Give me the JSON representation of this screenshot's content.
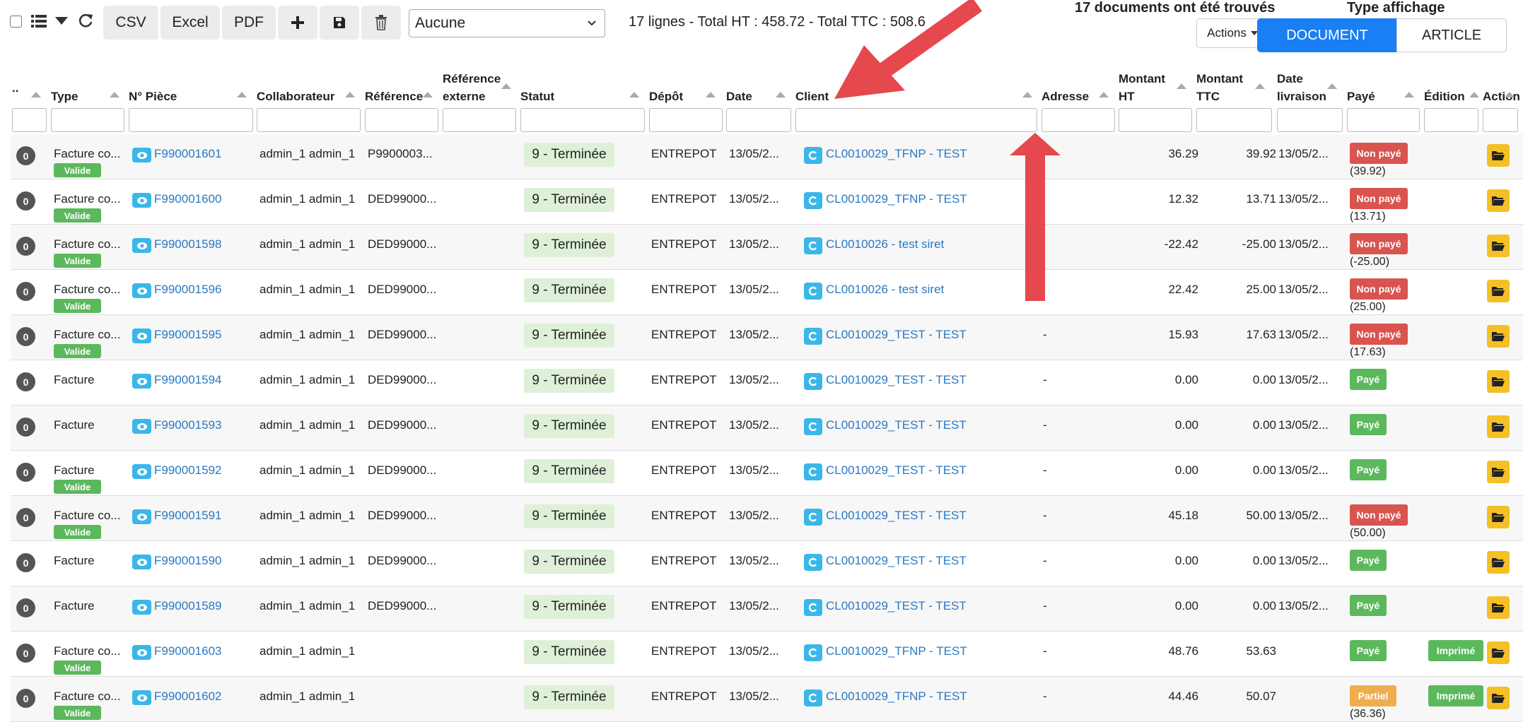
{
  "toolbar": {
    "csv_label": "CSV",
    "excel_label": "Excel",
    "pdf_label": "PDF",
    "view_select_value": "Aucune",
    "summary": "17 lignes - Total HT : 458.72 - Total TTC : 508.65"
  },
  "header": {
    "found_text": "17 documents ont été trouvés",
    "display_type_title": "Type affichage",
    "actions_label": "Actions",
    "document_label": "DOCUMENT",
    "article_label": "ARTICLE"
  },
  "columns": {
    "dots": "..",
    "type": "Type",
    "piece": "N° Pièce",
    "collab": "Collaborateur",
    "ref": "Référence",
    "refext_1": "Référence",
    "refext_2": "externe",
    "statut": "Statut",
    "depot": "Dépôt",
    "date": "Date",
    "client": "Client",
    "adresse": "Adresse",
    "mht_1": "Montant",
    "mht_2": "HT",
    "mttc_1": "Montant",
    "mttc_2": "TTC",
    "dliv_1": "Date",
    "dliv_2": "livraison",
    "paye": "Payé",
    "edition": "Édition",
    "action": "Action"
  },
  "rows": [
    {
      "badge": "0",
      "type": "Facture co...",
      "valide": "Valide",
      "piece": "F990001601",
      "collab": "admin_1 admin_1",
      "ref": "P9900003...",
      "statut": "9 - Terminée",
      "depot": "ENTREPOT",
      "date": "13/05/2...",
      "client": "CL0010029_TFNP - TEST",
      "adresse": "",
      "ht": "36.29",
      "ttc": "39.92",
      "dliv": "13/05/2...",
      "paye": "Non payé",
      "paye_kind": "np",
      "paye_sub": "(39.92)",
      "edition": ""
    },
    {
      "badge": "0",
      "type": "Facture co...",
      "valide": "Valide",
      "piece": "F990001600",
      "collab": "admin_1 admin_1",
      "ref": "DED99000...",
      "statut": "9 - Terminée",
      "depot": "ENTREPOT",
      "date": "13/05/2...",
      "client": "CL0010029_TFNP - TEST",
      "adresse": "",
      "ht": "12.32",
      "ttc": "13.71",
      "dliv": "13/05/2...",
      "paye": "Non payé",
      "paye_kind": "np",
      "paye_sub": "(13.71)",
      "edition": ""
    },
    {
      "badge": "0",
      "type": "Facture co...",
      "valide": "Valide",
      "piece": "F990001598",
      "collab": "admin_1 admin_1",
      "ref": "DED99000...",
      "statut": "9 - Terminée",
      "depot": "ENTREPOT",
      "date": "13/05/2...",
      "client": "CL0010026 - test siret",
      "adresse": "",
      "ht": "-22.42",
      "ttc": "-25.00",
      "dliv": "13/05/2...",
      "paye": "Non payé",
      "paye_kind": "np",
      "paye_sub": "(-25.00)",
      "edition": ""
    },
    {
      "badge": "0",
      "type": "Facture co...",
      "valide": "Valide",
      "piece": "F990001596",
      "collab": "admin_1 admin_1",
      "ref": "DED99000...",
      "statut": "9 - Terminée",
      "depot": "ENTREPOT",
      "date": "13/05/2...",
      "client": "CL0010026 - test siret",
      "adresse": "",
      "ht": "22.42",
      "ttc": "25.00",
      "dliv": "13/05/2...",
      "paye": "Non payé",
      "paye_kind": "np",
      "paye_sub": "(25.00)",
      "edition": ""
    },
    {
      "badge": "0",
      "type": "Facture co...",
      "valide": "Valide",
      "piece": "F990001595",
      "collab": "admin_1 admin_1",
      "ref": "DED99000...",
      "statut": "9 - Terminée",
      "depot": "ENTREPOT",
      "date": "13/05/2...",
      "client": "CL0010029_TEST - TEST",
      "adresse": "-",
      "ht": "15.93",
      "ttc": "17.63",
      "dliv": "13/05/2...",
      "paye": "Non payé",
      "paye_kind": "np",
      "paye_sub": "(17.63)",
      "edition": ""
    },
    {
      "badge": "0",
      "type": "Facture",
      "valide": "",
      "piece": "F990001594",
      "collab": "admin_1 admin_1",
      "ref": "DED99000...",
      "statut": "9 - Terminée",
      "depot": "ENTREPOT",
      "date": "13/05/2...",
      "client": "CL0010029_TEST - TEST",
      "adresse": "-",
      "ht": "0.00",
      "ttc": "0.00",
      "dliv": "13/05/2...",
      "paye": "Payé",
      "paye_kind": "p",
      "paye_sub": "",
      "edition": ""
    },
    {
      "badge": "0",
      "type": "Facture",
      "valide": "",
      "piece": "F990001593",
      "collab": "admin_1 admin_1",
      "ref": "DED99000...",
      "statut": "9 - Terminée",
      "depot": "ENTREPOT",
      "date": "13/05/2...",
      "client": "CL0010029_TEST - TEST",
      "adresse": "-",
      "ht": "0.00",
      "ttc": "0.00",
      "dliv": "13/05/2...",
      "paye": "Payé",
      "paye_kind": "p",
      "paye_sub": "",
      "edition": ""
    },
    {
      "badge": "0",
      "type": "Facture",
      "valide": "Valide",
      "piece": "F990001592",
      "collab": "admin_1 admin_1",
      "ref": "DED99000...",
      "statut": "9 - Terminée",
      "depot": "ENTREPOT",
      "date": "13/05/2...",
      "client": "CL0010029_TEST - TEST",
      "adresse": "-",
      "ht": "0.00",
      "ttc": "0.00",
      "dliv": "13/05/2...",
      "paye": "Payé",
      "paye_kind": "p",
      "paye_sub": "",
      "edition": ""
    },
    {
      "badge": "0",
      "type": "Facture co...",
      "valide": "Valide",
      "piece": "F990001591",
      "collab": "admin_1 admin_1",
      "ref": "DED99000...",
      "statut": "9 - Terminée",
      "depot": "ENTREPOT",
      "date": "13/05/2...",
      "client": "CL0010029_TEST - TEST",
      "adresse": "-",
      "ht": "45.18",
      "ttc": "50.00",
      "dliv": "13/05/2...",
      "paye": "Non payé",
      "paye_kind": "np",
      "paye_sub": "(50.00)",
      "edition": ""
    },
    {
      "badge": "0",
      "type": "Facture",
      "valide": "",
      "piece": "F990001590",
      "collab": "admin_1 admin_1",
      "ref": "DED99000...",
      "statut": "9 - Terminée",
      "depot": "ENTREPOT",
      "date": "13/05/2...",
      "client": "CL0010029_TEST - TEST",
      "adresse": "-",
      "ht": "0.00",
      "ttc": "0.00",
      "dliv": "13/05/2...",
      "paye": "Payé",
      "paye_kind": "p",
      "paye_sub": "",
      "edition": ""
    },
    {
      "badge": "0",
      "type": "Facture",
      "valide": "",
      "piece": "F990001589",
      "collab": "admin_1 admin_1",
      "ref": "DED99000...",
      "statut": "9 - Terminée",
      "depot": "ENTREPOT",
      "date": "13/05/2...",
      "client": "CL0010029_TEST - TEST",
      "adresse": "-",
      "ht": "0.00",
      "ttc": "0.00",
      "dliv": "13/05/2...",
      "paye": "Payé",
      "paye_kind": "p",
      "paye_sub": "",
      "edition": ""
    },
    {
      "badge": "0",
      "type": "Facture co...",
      "valide": "Valide",
      "piece": "F990001603",
      "collab": "admin_1 admin_1",
      "ref": "",
      "statut": "9 - Terminée",
      "depot": "ENTREPOT",
      "date": "13/05/2...",
      "client": "CL0010029_TFNP - TEST",
      "adresse": "-",
      "ht": "48.76",
      "ttc": "53.63",
      "dliv": "",
      "paye": "Payé",
      "paye_kind": "p",
      "paye_sub": "",
      "edition": "Imprimé"
    },
    {
      "badge": "0",
      "type": "Facture co...",
      "valide": "Valide",
      "piece": "F990001602",
      "collab": "admin_1 admin_1",
      "ref": "",
      "statut": "9 - Terminée",
      "depot": "ENTREPOT",
      "date": "13/05/2...",
      "client": "CL0010029_TFNP - TEST",
      "adresse": "-",
      "ht": "44.46",
      "ttc": "50.07",
      "dliv": "",
      "paye": "Partiel",
      "paye_kind": "pa",
      "paye_sub": "(36.36)",
      "edition": "Imprimé"
    }
  ]
}
